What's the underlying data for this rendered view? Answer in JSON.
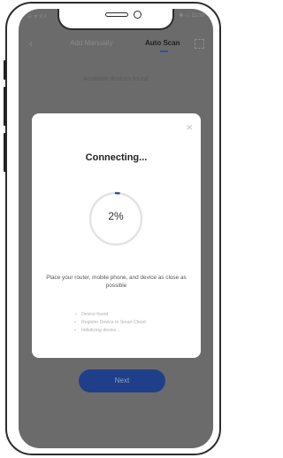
{
  "nav": {
    "back": "‹",
    "tab_manual": "Add Manually",
    "tab_auto": "Auto Scan"
  },
  "status": {
    "left": "⊖ ᯤ ıl ıl",
    "right": "✱ ▭ 11:16"
  },
  "list": {
    "heading": "Available devices found"
  },
  "dialog": {
    "close": "×",
    "title": "Connecting...",
    "progress_percent": 2,
    "progress_label": "2%",
    "tip": "Place your router, mobile phone, and device as close as possible",
    "steps": [
      {
        "icon": "✓",
        "label": "Device found"
      },
      {
        "icon": "•",
        "label": "Register Device to Smart Cloud"
      },
      {
        "icon": "•",
        "label": "Initializing device..."
      }
    ]
  },
  "footer": {
    "next": "Next"
  },
  "colors": {
    "overlay": "#6b6b6b",
    "accent": "#2f4fa3",
    "progress_track": "#e3e3e3",
    "button": "#203f8a"
  },
  "icons": {
    "back": "chevron-left-icon",
    "scan": "scan-frame-icon",
    "close": "close-icon",
    "check": "check-icon"
  }
}
